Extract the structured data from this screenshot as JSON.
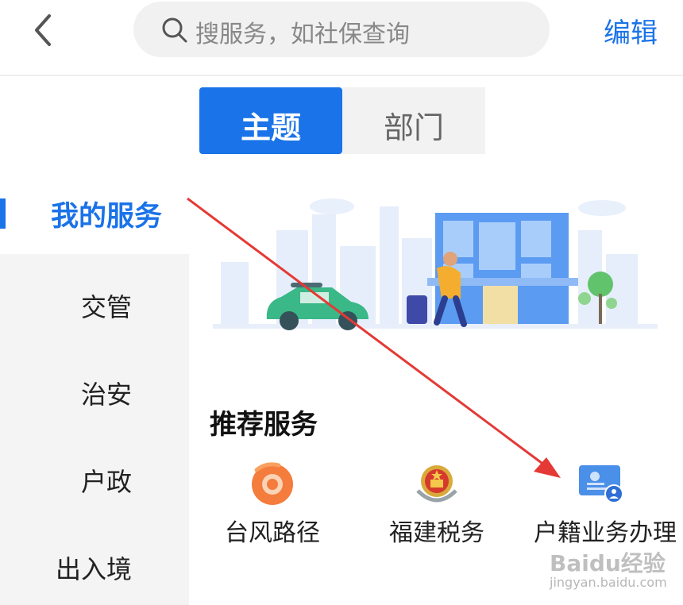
{
  "header": {
    "back_icon": "chevron-left-icon",
    "search_placeholder": "搜服务，如社保查询",
    "search_icon": "search-icon",
    "edit_label": "编辑"
  },
  "tabs": [
    {
      "label": "主题",
      "active": true
    },
    {
      "label": "部门",
      "active": false
    }
  ],
  "sidebar": {
    "items": [
      {
        "label": "我的服务",
        "active": true
      },
      {
        "label": "交管",
        "active": false
      },
      {
        "label": "治安",
        "active": false
      },
      {
        "label": "户政",
        "active": false
      },
      {
        "label": "出入境",
        "active": false
      }
    ]
  },
  "recommended": {
    "title": "推荐服务",
    "services": [
      {
        "label": "台风路径",
        "icon": "typhoon-icon"
      },
      {
        "label": "福建税务",
        "icon": "tax-emblem-icon"
      },
      {
        "label": "户籍业务办理",
        "icon": "id-card-icon"
      }
    ]
  },
  "watermark": {
    "brand": "Baidu经验",
    "url": "jingyan.baidu.com"
  },
  "colors": {
    "accent": "#1a73e8",
    "arrow": "#e53935"
  }
}
